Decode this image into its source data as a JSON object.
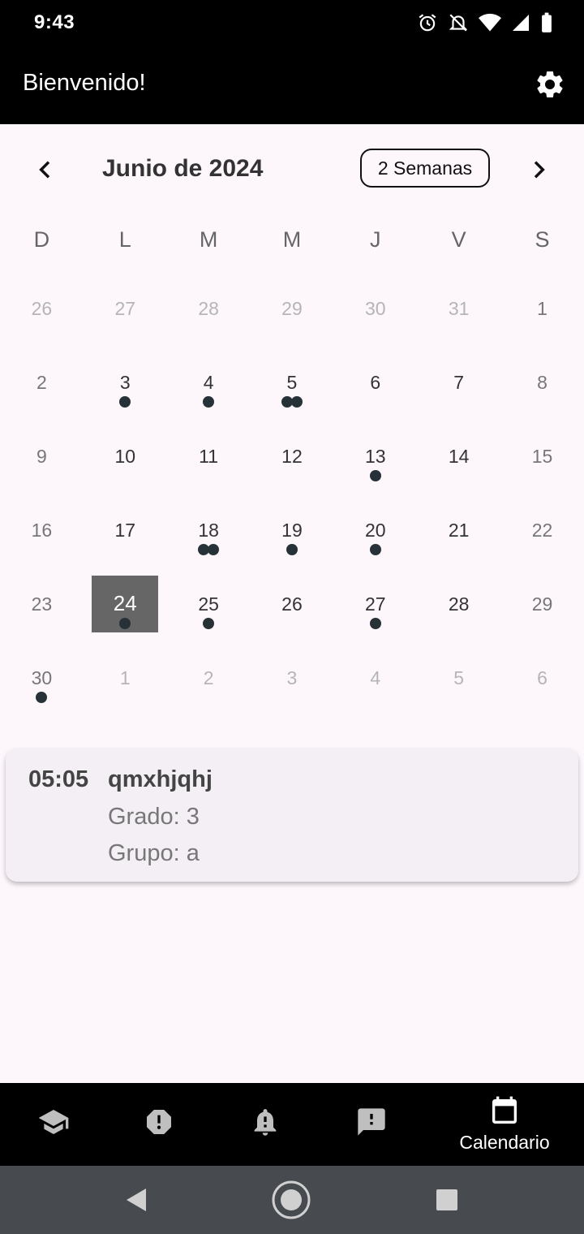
{
  "status": {
    "time": "9:43"
  },
  "appbar": {
    "title": "Bienvenido!"
  },
  "calendar": {
    "month_title": "Junio de 2024",
    "format_label": "2 Semanas",
    "weekdays": [
      "D",
      "L",
      "M",
      "M",
      "J",
      "V",
      "S"
    ],
    "weeks": [
      [
        {
          "n": "26",
          "o": true,
          "d": 0
        },
        {
          "n": "27",
          "o": true,
          "d": 0
        },
        {
          "n": "28",
          "o": true,
          "d": 0
        },
        {
          "n": "29",
          "o": true,
          "d": 0
        },
        {
          "n": "30",
          "o": true,
          "d": 0
        },
        {
          "n": "31",
          "o": true,
          "d": 0
        },
        {
          "n": "1",
          "o": false,
          "d": 0
        }
      ],
      [
        {
          "n": "2",
          "o": false,
          "d": 0
        },
        {
          "n": "3",
          "o": false,
          "d": 1
        },
        {
          "n": "4",
          "o": false,
          "d": 1
        },
        {
          "n": "5",
          "o": false,
          "d": 2
        },
        {
          "n": "6",
          "o": false,
          "d": 0
        },
        {
          "n": "7",
          "o": false,
          "d": 0
        },
        {
          "n": "8",
          "o": false,
          "d": 0
        }
      ],
      [
        {
          "n": "9",
          "o": false,
          "d": 0
        },
        {
          "n": "10",
          "o": false,
          "d": 0
        },
        {
          "n": "11",
          "o": false,
          "d": 0
        },
        {
          "n": "12",
          "o": false,
          "d": 0
        },
        {
          "n": "13",
          "o": false,
          "d": 1
        },
        {
          "n": "14",
          "o": false,
          "d": 0
        },
        {
          "n": "15",
          "o": false,
          "d": 0
        }
      ],
      [
        {
          "n": "16",
          "o": false,
          "d": 0
        },
        {
          "n": "17",
          "o": false,
          "d": 0
        },
        {
          "n": "18",
          "o": false,
          "d": 2
        },
        {
          "n": "19",
          "o": false,
          "d": 1
        },
        {
          "n": "20",
          "o": false,
          "d": 1
        },
        {
          "n": "21",
          "o": false,
          "d": 0
        },
        {
          "n": "22",
          "o": false,
          "d": 0
        }
      ],
      [
        {
          "n": "23",
          "o": false,
          "d": 0
        },
        {
          "n": "24",
          "o": false,
          "d": 1,
          "sel": true
        },
        {
          "n": "25",
          "o": false,
          "d": 1
        },
        {
          "n": "26",
          "o": false,
          "d": 0
        },
        {
          "n": "27",
          "o": false,
          "d": 1
        },
        {
          "n": "28",
          "o": false,
          "d": 0
        },
        {
          "n": "29",
          "o": false,
          "d": 0
        }
      ],
      [
        {
          "n": "30",
          "o": false,
          "d": 1
        },
        {
          "n": "1",
          "o": true,
          "d": 0
        },
        {
          "n": "2",
          "o": true,
          "d": 0
        },
        {
          "n": "3",
          "o": true,
          "d": 0
        },
        {
          "n": "4",
          "o": true,
          "d": 0
        },
        {
          "n": "5",
          "o": true,
          "d": 0
        },
        {
          "n": "6",
          "o": true,
          "d": 0
        }
      ]
    ]
  },
  "event": {
    "time": "05:05",
    "name": "qmxhjqhj",
    "grado": "Grado: 3",
    "grupo": "Grupo: a"
  },
  "bottom_nav": {
    "items": [
      {
        "icon": "school-icon",
        "label": ""
      },
      {
        "icon": "report-icon",
        "label": ""
      },
      {
        "icon": "notification-bell-icon",
        "label": ""
      },
      {
        "icon": "feedback-icon",
        "label": ""
      },
      {
        "icon": "calendar-icon",
        "label": "Calendario",
        "active": true
      }
    ]
  },
  "colors": {
    "accent_bar": "#000000",
    "selected_day": "#666666",
    "marker": "#263238",
    "background": "#fdf7fc"
  }
}
